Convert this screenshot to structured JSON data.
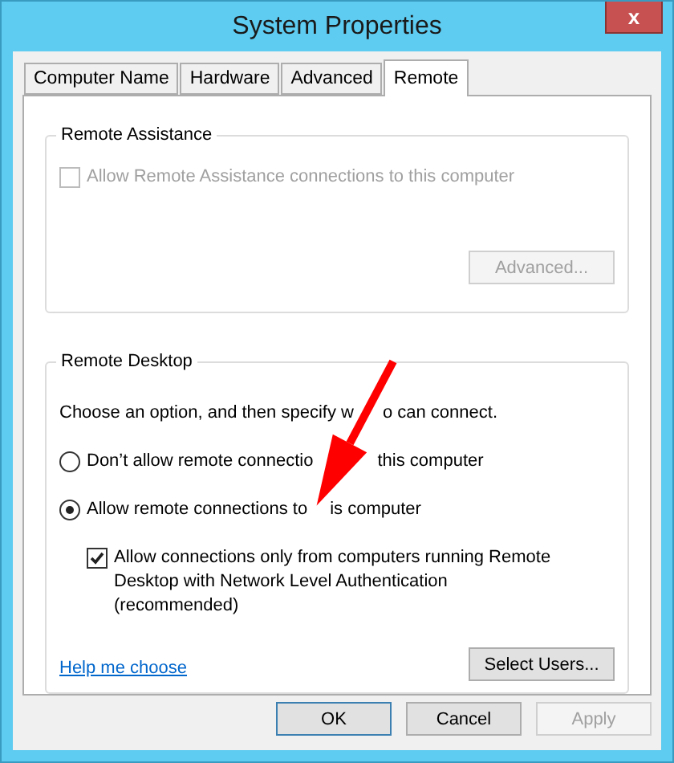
{
  "window": {
    "title": "System Properties",
    "close": "x"
  },
  "tabs": [
    {
      "label": "Computer Name",
      "selected": false
    },
    {
      "label": "Hardware",
      "selected": false
    },
    {
      "label": "Advanced",
      "selected": false
    },
    {
      "label": "Remote",
      "selected": true
    }
  ],
  "remote_assistance": {
    "title": "Remote Assistance",
    "checkbox": {
      "label": "Allow Remote Assistance connections to this computer",
      "checked": false,
      "disabled": true
    },
    "button": {
      "label": "Advanced...",
      "disabled": true
    }
  },
  "remote_desktop": {
    "title": "Remote Desktop",
    "intro": [
      "Choose an option, and then specify w",
      "o can connect."
    ],
    "options": [
      {
        "label": [
          "Don’t allow remote connectio",
          "this computer"
        ],
        "selected": false
      },
      {
        "label": [
          "Allow remote connections to",
          "is computer"
        ],
        "selected": true
      }
    ],
    "nla": {
      "label": "Allow connections only from computers running Remote Desktop with Network Level Authentication (recommended)",
      "checked": true,
      "disabled": false
    },
    "help_link": "Help me choose",
    "button": {
      "label": "Select Users...",
      "disabled": false
    }
  },
  "buttons": [
    {
      "label": "OK",
      "disabled": false,
      "default": true
    },
    {
      "label": "Cancel",
      "disabled": false,
      "default": false
    },
    {
      "label": "Apply",
      "disabled": true,
      "default": false
    }
  ]
}
